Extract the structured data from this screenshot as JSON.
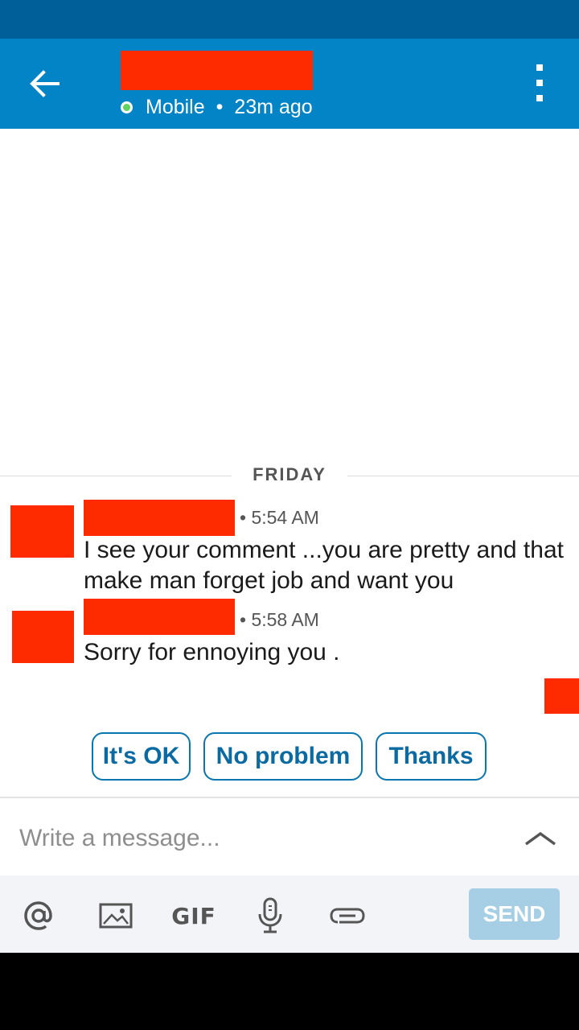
{
  "header": {
    "presence_status": "Mobile",
    "separator": "•",
    "last_active": "23m ago",
    "back_icon": "arrow-left-icon",
    "menu_icon": "more-vert-icon"
  },
  "conversation": {
    "day_label": "FRIDAY",
    "messages": [
      {
        "time": "5:54 AM",
        "separator": "•",
        "text": "I see your comment ...you are pretty and that make man forget job and want you"
      },
      {
        "time": "5:58 AM",
        "separator": "•",
        "text": "Sorry for ennoying you ."
      }
    ]
  },
  "smart_replies": [
    "It's OK",
    "No problem",
    "Thanks"
  ],
  "composer": {
    "placeholder": "Write a message...",
    "expand_icon": "chevron-up-icon"
  },
  "toolbar": {
    "icons": [
      "at-mention-icon",
      "image-icon",
      "gif-icon",
      "microphone-icon",
      "paperclip-icon"
    ],
    "gif_label": "GIF",
    "send_label": "SEND"
  },
  "colors": {
    "app_bar": "#0284c6",
    "status_bar": "#005f99",
    "redaction": "#ff2b00",
    "accent": "#0a76b0",
    "send_disabled": "#a6cfe6"
  }
}
